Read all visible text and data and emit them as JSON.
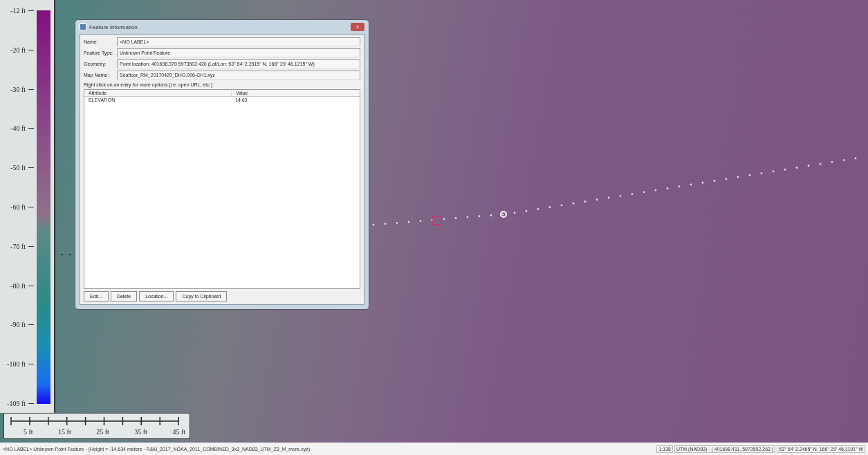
{
  "legend": {
    "labels": [
      "-12 ft",
      "-20 ft",
      "-30 ft",
      "-40 ft",
      "-50 ft",
      "-60 ft",
      "-70 ft",
      "-80 ft",
      "-90 ft",
      "-100 ft",
      "-109 ft"
    ]
  },
  "scale_bar": {
    "labels": [
      "5 ft",
      "15 ft",
      "25 ft",
      "35 ft",
      "45 ft"
    ]
  },
  "dialog": {
    "title": "Feature Information",
    "close": "x",
    "fields": [
      {
        "label": "Name:",
        "value": "<NO LABEL>"
      },
      {
        "label": "Feature Type:",
        "value": "Unknown Point Feature"
      },
      {
        "label": "Geometry:",
        "value": "Point location: 401698.370 5973502.420 (Lat/Lon: 53° 54' 2.2515\" N, 166° 29' 46.1215\" W)"
      },
      {
        "label": "Map Name:",
        "value": "Seafloor_RM_20170420_DHG.006-CH1.xyz"
      }
    ],
    "hint": "Right click on an entry for more options (i.e. open URL, etc.)",
    "table": {
      "columns": [
        "Attribute",
        "Value"
      ],
      "rows": [
        [
          "ELEVATION",
          "14.63"
        ]
      ]
    },
    "buttons": [
      "Edit...",
      "Delete",
      "Location...",
      "Copy to Clipboard"
    ]
  },
  "status_bar": {
    "left": "<NO LABEL> Unknown Point Feature - (Height = -14.634 meters - R&M_2017_NOAA_2011_COMBINED_3x3_NAD83_UTM_Z3_M_more.xyz)",
    "right": [
      "1:138",
      "UTM (NAD83) - ( 401698.411, 5973502.263 )",
      "53° 54' 2.2465\" N, 166° 29' 46.1191\" W"
    ]
  }
}
